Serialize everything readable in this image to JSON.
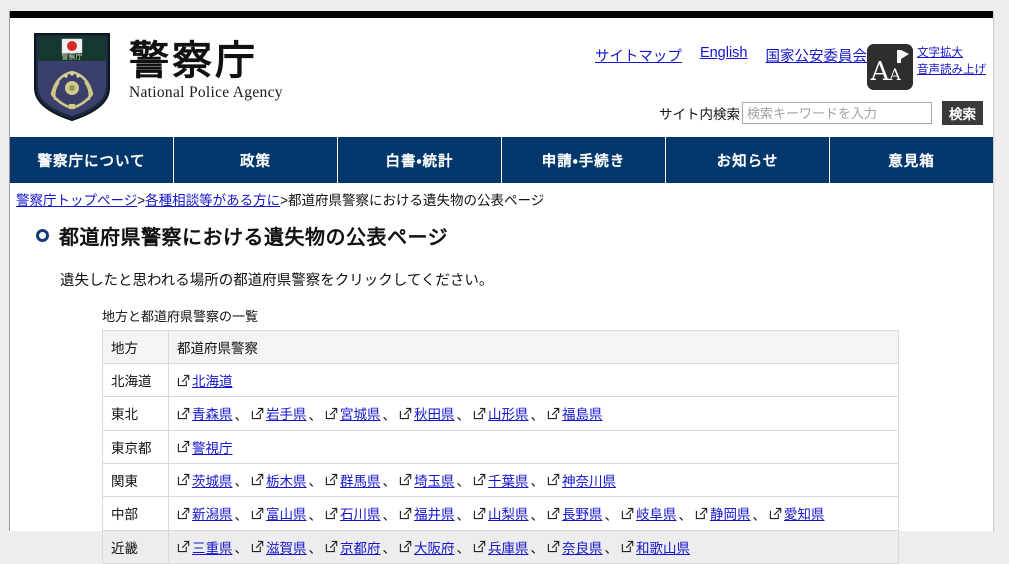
{
  "header": {
    "brand_jp": "警察庁",
    "brand_en": "National Police Agency",
    "emblem_icon": "police-shield-emblem",
    "util_links": [
      {
        "label": "サイトマップ",
        "name": "sitemap-link"
      },
      {
        "label": "English",
        "name": "english-link"
      },
      {
        "label": "国家公安委員会",
        "name": "public-safety-commission-link"
      }
    ],
    "accessibility": {
      "icon": "text-size-speech-icon",
      "big_a": "A",
      "small_a": "A",
      "links": [
        {
          "label": "文字拡大",
          "name": "enlarge-text-link"
        },
        {
          "label": "音声読み上げ",
          "name": "text-to-speech-link"
        }
      ]
    },
    "search": {
      "label": "サイト内検索",
      "placeholder": "検索キーワードを入力",
      "value": "",
      "button_label": "検索"
    }
  },
  "global_nav": {
    "background": "#03376b",
    "items": [
      {
        "label": "警察庁について",
        "name": "nav-about"
      },
      {
        "label": "政策",
        "name": "nav-policy"
      },
      {
        "label": "白書・統計",
        "name": "nav-whitepaper-statistics"
      },
      {
        "label": "申請・手続き",
        "name": "nav-applications-procedures"
      },
      {
        "label": "お知らせ",
        "name": "nav-notices"
      },
      {
        "label": "意見箱",
        "name": "nav-opinion-box"
      }
    ]
  },
  "breadcrumb": {
    "items": [
      {
        "label": "警察庁トップページ",
        "link": true
      },
      {
        "label": "各種相談等がある方に",
        "link": true
      },
      {
        "label": "都道府県警察における遺失物の公表ページ",
        "link": false
      }
    ],
    "separator": ">"
  },
  "main": {
    "page_title": "都道府県警察における遺失物の公表ページ",
    "lead_text": "遺失したと思われる場所の都道府県警察をクリックしてください。",
    "table_caption": "地方と都道府県警察の一覧",
    "table": {
      "headers": [
        "地方",
        "都道府県警察"
      ],
      "rows": [
        {
          "region": "北海道",
          "police": [
            "北海道"
          ]
        },
        {
          "region": "東北",
          "police": [
            "青森県",
            "岩手県",
            "宮城県",
            "秋田県",
            "山形県",
            "福島県"
          ]
        },
        {
          "region": "東京都",
          "police": [
            "警視庁"
          ]
        },
        {
          "region": "関東",
          "police": [
            "茨城県",
            "栃木県",
            "群馬県",
            "埼玉県",
            "千葉県",
            "神奈川県"
          ]
        },
        {
          "region": "中部",
          "police": [
            "新潟県",
            "富山県",
            "石川県",
            "福井県",
            "山梨県",
            "長野県",
            "岐阜県",
            "静岡県",
            "愛知県"
          ]
        },
        {
          "region": "近畿",
          "police": [
            "三重県",
            "滋賀県",
            "京都府",
            "大阪府",
            "兵庫県",
            "奈良県",
            "和歌山県"
          ]
        }
      ],
      "link_separator": "、",
      "external_icon": "external-link-icon"
    }
  },
  "colors": {
    "nav_navy": "#03376b",
    "link_blue": "#1515cc",
    "page_bg": "#ededed",
    "table_header_bg": "#f4f4f4"
  }
}
